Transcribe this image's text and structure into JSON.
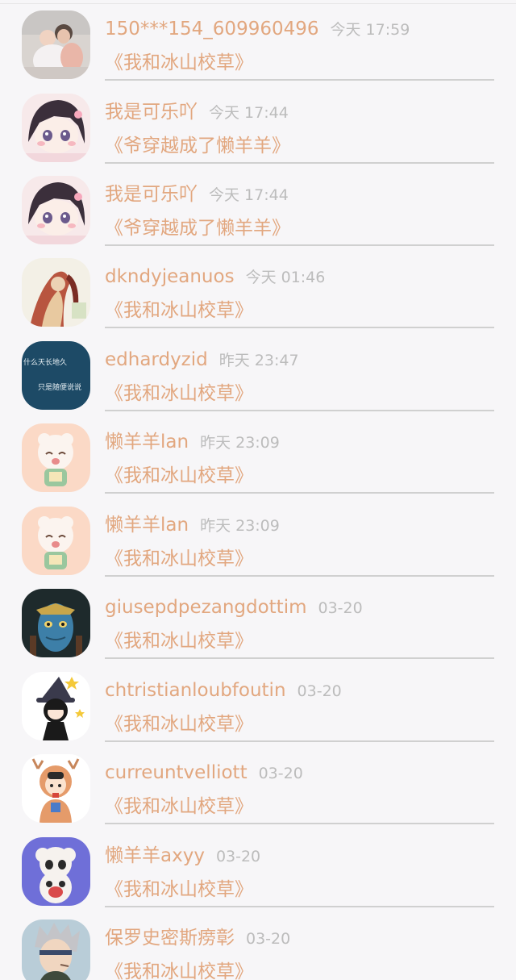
{
  "feed": {
    "items": [
      {
        "username": "150***154_609960496",
        "time": "今天 17:59",
        "book": "《我和冰山校草》",
        "avatar": "baby-photo-avatar"
      },
      {
        "username": "我是可乐吖",
        "time": "今天 17:44",
        "book": "《爷穿越成了懒羊羊》",
        "avatar": "anime-girl-avatar"
      },
      {
        "username": "我是可乐吖",
        "time": "今天 17:44",
        "book": "《爷穿越成了懒羊羊》",
        "avatar": "anime-girl-avatar"
      },
      {
        "username": "dkndyjeanuos",
        "time": "今天 01:46",
        "book": "《我和冰山校草》",
        "avatar": "illustration-avatar"
      },
      {
        "username": "edhardyzid",
        "time": "昨天 23:47",
        "book": "《我和冰山校草》",
        "avatar": "text-image-avatar",
        "avatar_text": [
          "什么天长地久",
          "只是随便说说"
        ]
      },
      {
        "username": "懒羊羊lan",
        "time": "昨天 23:09",
        "book": "《我和冰山校草》",
        "avatar": "cartoon-sheep-avatar"
      },
      {
        "username": "懒羊羊lan",
        "time": "昨天 23:09",
        "book": "《我和冰山校草》",
        "avatar": "cartoon-sheep-avatar"
      },
      {
        "username": "giusepdpezangdottim",
        "time": "03-20",
        "book": "《我和冰山校草》",
        "avatar": "avatar-character-avatar"
      },
      {
        "username": "chtristianloubfoutin",
        "time": "03-20",
        "book": "《我和冰山校草》",
        "avatar": "witch-girl-avatar"
      },
      {
        "username": "curreuntvelliott",
        "time": "03-20",
        "book": "《我和冰山校草》",
        "avatar": "deer-costume-child-avatar"
      },
      {
        "username": "懒羊羊axyy",
        "time": "03-20",
        "book": "《我和冰山校草》",
        "avatar": "pleasant-goat-avatar"
      },
      {
        "username": "保罗史密斯痨彰",
        "time": "03-20",
        "book": "《我和冰山校草》",
        "avatar": "anime-boy-avatar"
      }
    ]
  },
  "colors": {
    "username": "#e2a77f",
    "book": "#e2a77f",
    "time": "#bcbcbc",
    "background": "#f7f6f8",
    "divider": "#d0d0d0"
  }
}
